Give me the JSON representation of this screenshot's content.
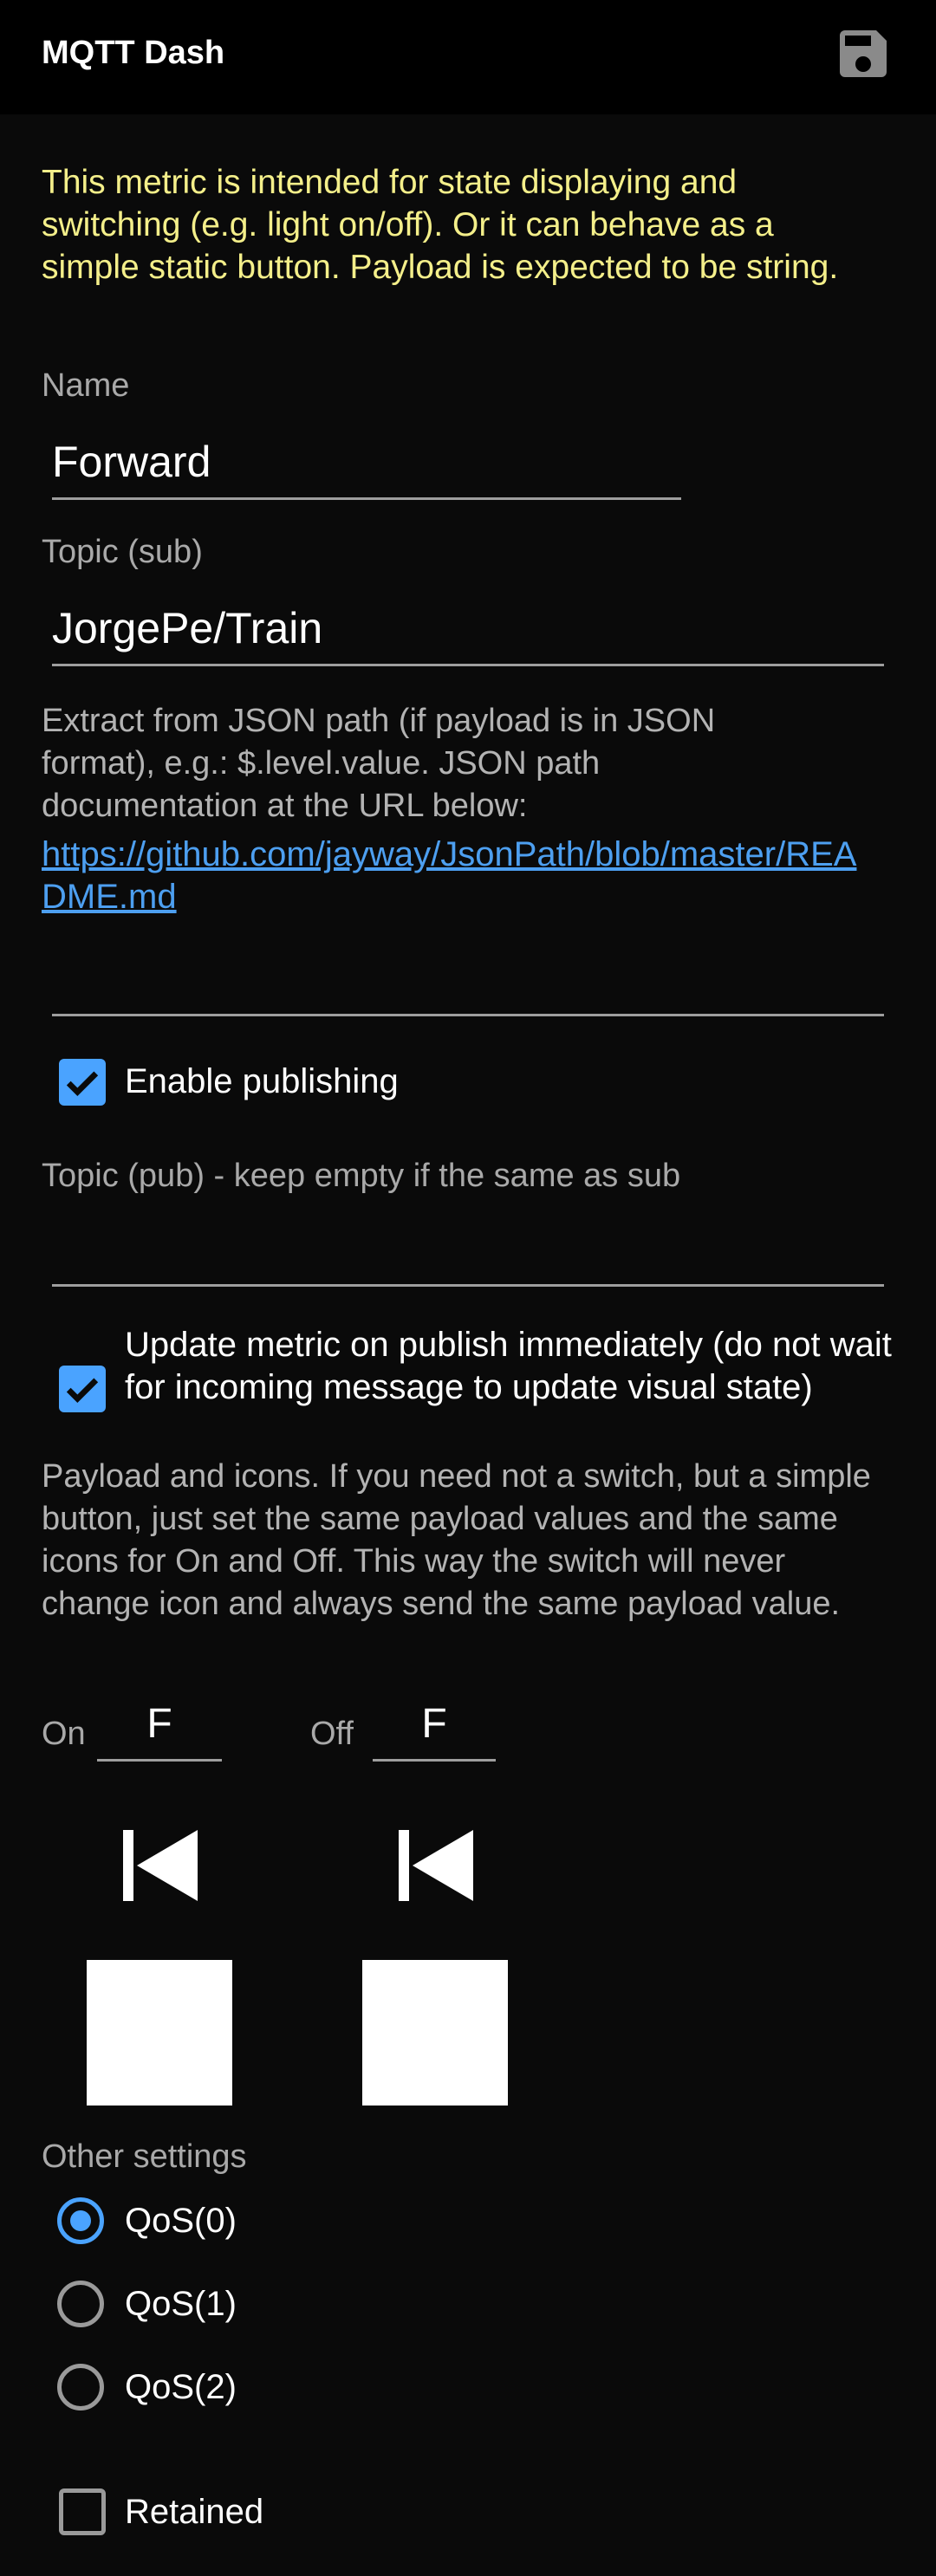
{
  "appbar": {
    "title": "MQTT Dash",
    "save_icon": "floppy-disk-icon"
  },
  "intro": "This metric is intended for state displaying and switching (e.g. light on/off). Or it can behave as a simple static button. Payload is expected to be string.",
  "name_field": {
    "label": "Name",
    "value": "Forward"
  },
  "topic_sub": {
    "label": "Topic (sub)",
    "value": "JorgePe/Train"
  },
  "json_path": {
    "help": "Extract from JSON path (if payload is in JSON format), e.g.: $.level.value. JSON path documentation at the URL below:",
    "link": "https://github.com/jayway/JsonPath/blob/master/README.md",
    "value": ""
  },
  "enable_publishing": {
    "label": "Enable publishing",
    "checked": true
  },
  "topic_pub": {
    "label": "Topic (pub) - keep empty if the same as sub",
    "value": ""
  },
  "update_immediately": {
    "label": "Update metric on publish immediately (do not wait for incoming message to update visual state)",
    "checked": true
  },
  "payload_help": "Payload and icons. If you need not a switch, but a simple button, just set the same payload values and the same icons for On and Off. This way the switch will never change icon and always send the same payload value.",
  "on": {
    "label": "On",
    "value": "F",
    "icon": "skip-previous-icon",
    "color": "#ffffff"
  },
  "off": {
    "label": "Off",
    "value": "F",
    "icon": "skip-previous-icon",
    "color": "#ffffff"
  },
  "other_settings": {
    "label": "Other settings",
    "qos": [
      {
        "label": "QoS(0)",
        "selected": true
      },
      {
        "label": "QoS(1)",
        "selected": false
      },
      {
        "label": "QoS(2)",
        "selected": false
      }
    ],
    "retained": {
      "label": "Retained",
      "checked": false
    }
  },
  "colors": {
    "accent": "#4aa3ff",
    "intro_text": "#f4ef8a",
    "link": "#4d9ff0"
  }
}
